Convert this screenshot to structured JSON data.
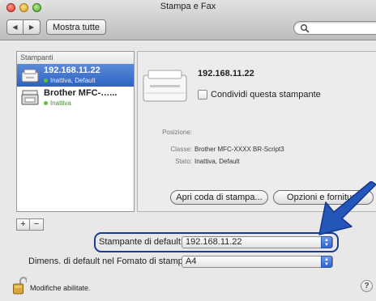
{
  "window": {
    "title": "Stampa e Fax"
  },
  "toolbar": {
    "back_icon": "left-triangle",
    "forward_icon": "right-triangle",
    "show_all_label": "Mostra tutte",
    "search_placeholder": ""
  },
  "printers": {
    "header": "Stampanti",
    "items": [
      {
        "name": "192.168.11.22",
        "status": "Inattiva, Default",
        "selected": true
      },
      {
        "name": "Brother MFC-…...",
        "status": "Inattiva",
        "selected": false
      }
    ],
    "add_label": "+",
    "remove_label": "−"
  },
  "detail": {
    "name": "192.168.11.22",
    "share_label": "Condividi questa stampante",
    "location_label": "Posizione:",
    "location_value": "",
    "kind_label": "Classe:",
    "kind_value": "Brother MFC-XXXX BR-Script3",
    "status_label": "Stato:",
    "status_value": "Inattiva, Default",
    "open_queue_label": "Apri coda di stampa...",
    "options_label": "Opzioni e forniture"
  },
  "defaults": {
    "default_printer_label": "Stampante di default:",
    "default_printer_value": "192.168.11.22",
    "paper_size_label": "Dimens. di default nel Fomato di stampa:",
    "paper_size_value": "A4"
  },
  "footer": {
    "lock_text": "Modifiche abilitate.",
    "help_label": "?"
  },
  "colors": {
    "selection": "#2d62c4",
    "callout": "#1b3c8f",
    "status_dot": "#5fbf3a"
  }
}
